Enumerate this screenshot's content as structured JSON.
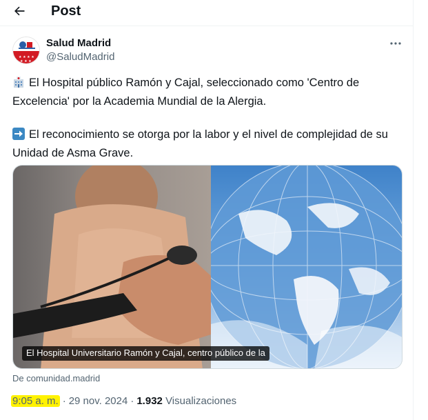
{
  "header": {
    "title": "Post",
    "back_icon": "arrow-left-icon"
  },
  "author": {
    "name": "Salud Madrid",
    "handle": "@SaludMadrid",
    "avatar_icon": "comunidad-madrid-logo"
  },
  "more_icon": "more-horizontal-icon",
  "tweet": {
    "paragraph1": "El Hospital público Ramón y Cajal, seleccionado como 'Centro de Excelencia' por la Academia Mundial de la Alergia.",
    "paragraph1_emoji": "hospital-icon",
    "paragraph2": "El reconocimiento se otorga por la labor y el nivel de complejidad de su Unidad de Asma Grave.",
    "paragraph2_emoji": "right-arrow-icon"
  },
  "media": {
    "caption": "El Hospital Universitario Ramón y Cajal, centro público de la",
    "source": "De comunidad.madrid"
  },
  "meta": {
    "time": "9:05 a. m.",
    "separator": "·",
    "date": "29 nov. 2024",
    "views_count": "1.932",
    "views_label": "Visualizaciones"
  },
  "colors": {
    "highlight": "#fff200",
    "secondary_text": "#536471",
    "primary_text": "#0f1419"
  }
}
